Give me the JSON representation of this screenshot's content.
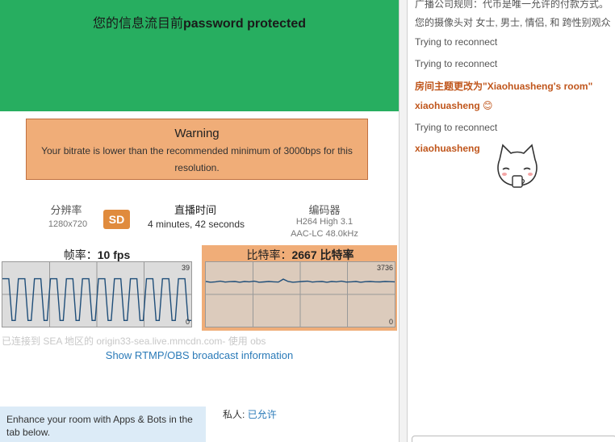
{
  "banner": {
    "prefix": "您的信息流目前",
    "status": "password protected"
  },
  "warning": {
    "title": "Warning",
    "message": "Your bitrate is lower than the recommended minimum of 3000bps for this resolution."
  },
  "stats": {
    "resolution": {
      "label": "分辨率",
      "value": "1280x720"
    },
    "quality_badge": "SD",
    "live_time": {
      "label": "直播时间",
      "value": "4 minutes, 42 seconds"
    },
    "encoder": {
      "label": "编码器",
      "video": "H264 High 3.1",
      "audio": "AAC-LC 48.0kHz"
    }
  },
  "fps_chart": {
    "label": "帧率：",
    "value": "10 fps",
    "ymax": "39",
    "ymin": "0"
  },
  "bitrate_chart": {
    "label": "比特率：",
    "value": "2667 比特率",
    "ymax": "3736",
    "ymin": "0"
  },
  "chart_data": [
    {
      "type": "line",
      "title": "帧率：10 fps",
      "ylim": [
        0,
        39
      ],
      "grid": true,
      "values": [
        30,
        30,
        30,
        2,
        2,
        30,
        30,
        30,
        2,
        2,
        30,
        30,
        30,
        2,
        2,
        30,
        30,
        30,
        2,
        2,
        30,
        30,
        30,
        2,
        2,
        30,
        30,
        30,
        2,
        2,
        30,
        30,
        30,
        2,
        2,
        30,
        30,
        30,
        2,
        2,
        30,
        30,
        30,
        2,
        2,
        30,
        30,
        30,
        2,
        2,
        30,
        30,
        30,
        2,
        2,
        30,
        30,
        30,
        2,
        2
      ],
      "color": "#1f4e79"
    },
    {
      "type": "line",
      "title": "比特率：2667 比特率",
      "ylim": [
        0,
        3736
      ],
      "grid": true,
      "values": [
        2700,
        2650,
        2680,
        2720,
        2660,
        2690,
        2700,
        2650,
        2700,
        2680,
        2720,
        2650,
        2670,
        2700,
        2680,
        2660,
        2850,
        2700,
        2650,
        2680,
        2700,
        2720,
        2660,
        2690,
        2700,
        2650,
        2700,
        2680,
        2720,
        2660,
        2680,
        2700,
        2650,
        2690,
        2700,
        2680,
        2670,
        2700,
        2690,
        2680
      ],
      "color": "#1f4e79"
    }
  ],
  "connection": "已连接到 SEA 地区的 origin33-sea.live.mmcdn.com- 使用 obs",
  "rtmp_link": "Show RTMP/OBS broadcast information",
  "apps_box": "Enhance your room with Apps & Bots in the tab below.",
  "private": {
    "label": "私人:",
    "value": "已允许"
  },
  "chat": {
    "messages": [
      {
        "kind": "sys",
        "text": "广播公司规则：代币是唯一允许的付款方式。"
      },
      {
        "kind": "sys",
        "text": "您的摄像头对 女士, 男士, 情侣, 和 跨性别观众"
      },
      {
        "kind": "sys",
        "text": "Trying to reconnect"
      },
      {
        "kind": "sys",
        "text": "Trying to reconnect"
      },
      {
        "kind": "topic",
        "text": "房间主题更改为\"Xiaohuasheng's room\""
      },
      {
        "kind": "user",
        "text": "xiaohuasheng 😊"
      },
      {
        "kind": "sys",
        "text": "Trying to reconnect"
      },
      {
        "kind": "user",
        "text": "xiaohuasheng"
      }
    ]
  }
}
